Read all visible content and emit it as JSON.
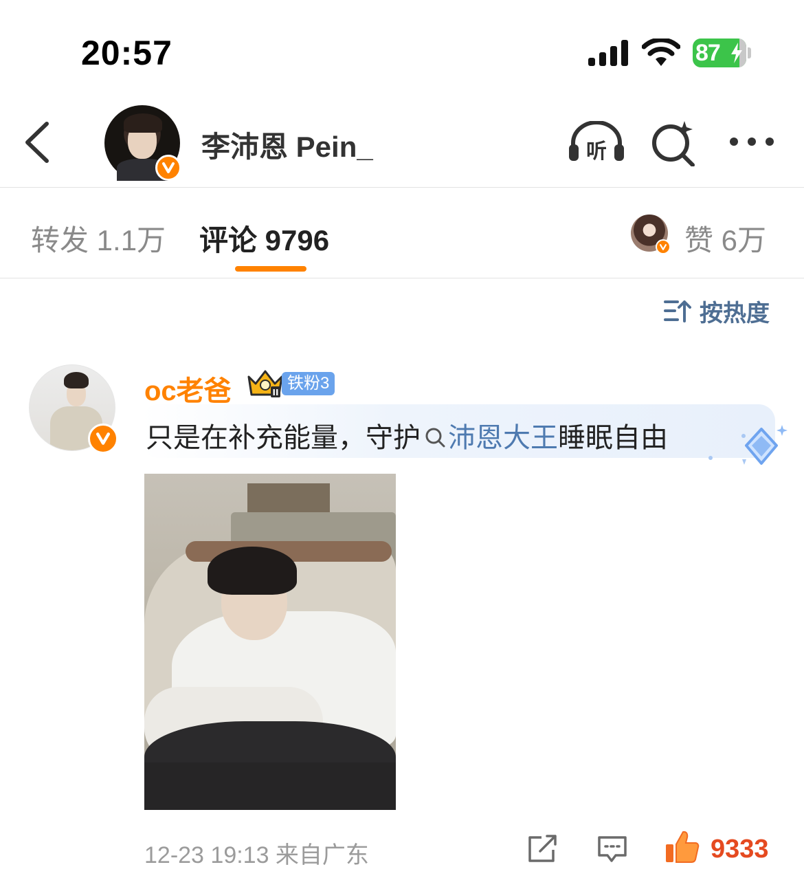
{
  "status_bar": {
    "time": "20:57",
    "battery_percent": "87",
    "battery_level": 0.87,
    "battery_color": "#3cc44a",
    "icons": [
      "cellular-signal-icon",
      "wifi-icon",
      "battery-charging-icon"
    ]
  },
  "header": {
    "title": "李沛恩 Pein_",
    "icons": [
      "back-arrow-icon",
      "listen-headphones-icon",
      "search-sparkle-icon",
      "more-dots-icon"
    ],
    "listen_glyph": "听"
  },
  "tabs": {
    "repost_label": "转发 1.1万",
    "comments_label": "评论 9796",
    "likes_label": "赞 6万",
    "accent_color": "#ff8200"
  },
  "sort": {
    "label": "按热度"
  },
  "comment": {
    "username": "oc老爸",
    "fan_badge": "铁粉3",
    "text_before": "只是在补充能量，守护",
    "topic": "沛恩大王",
    "text_after": "睡眠自由",
    "meta": "12-23 19:13 来自广东",
    "like_count": "9333",
    "username_color": "#ff8200",
    "topic_color": "#4e7ab0",
    "like_color": "#e54a20"
  }
}
